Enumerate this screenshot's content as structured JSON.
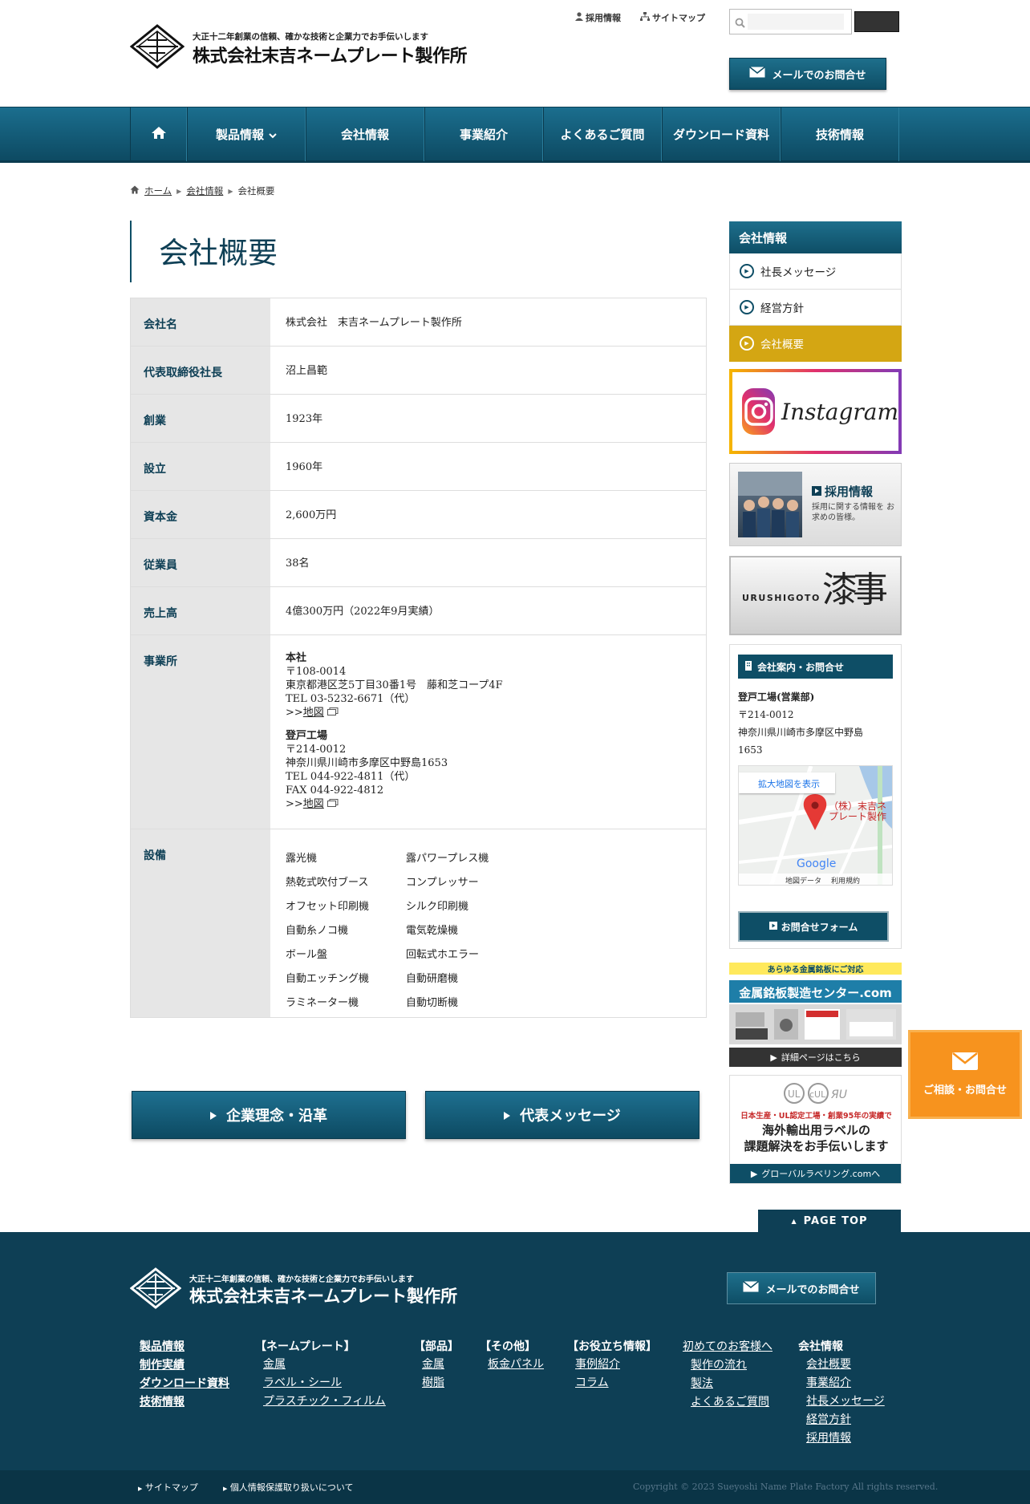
{
  "header": {
    "tagline": "大正十二年創業の信頼、確かな技術と企業力でお手伝いします",
    "company_name": "株式会社末吉ネームプレート製作所",
    "util_links": [
      "採用情報",
      "サイトマップ"
    ],
    "mail_button": "メールでのお問合せ"
  },
  "nav": {
    "items": [
      "製品情報",
      "会社情報",
      "事業紹介",
      "よくあるご質問",
      "ダウンロード資料",
      "技術情報"
    ]
  },
  "breadcrumb": [
    "ホーム",
    "会社情報",
    "会社概要"
  ],
  "page_title": "会社概要",
  "company_table": {
    "rows": [
      {
        "label": "会社名",
        "value": "株式会社　末吉ネームプレート製作所"
      },
      {
        "label": "代表取締役社長",
        "value": "沼上昌範"
      },
      {
        "label": "創業",
        "value": "1923年"
      },
      {
        "label": "設立",
        "value": "1960年"
      },
      {
        "label": "資本金",
        "value": "2,600万円"
      },
      {
        "label": "従業員",
        "value": "38名"
      },
      {
        "label": "売上高",
        "value": "4億300万円（2022年9月実績）"
      }
    ],
    "offices_label": "事業所",
    "offices": [
      {
        "name": "本社",
        "lines": [
          "〒108-0014",
          "東京都港区芝5丁目30番1号　藤和芝コープ4F",
          "TEL 03-5232-6671（代）"
        ],
        "map_prefix": ">>",
        "map_link": "地図"
      },
      {
        "name": "登戸工場",
        "lines": [
          "〒214-0012",
          "神奈川県川崎市多摩区中野島1653",
          "TEL 044-922-4811（代）",
          "FAX 044-922-4812"
        ],
        "map_prefix": ">>",
        "map_link": "地図"
      }
    ],
    "equipment_label": "設備",
    "equipment": [
      "露光機",
      "露パワープレス機",
      "熱乾式吹付ブース",
      "コンプレッサー",
      "オフセット印刷機",
      "シルク印刷機",
      "自動糸ノコ機",
      "電気乾燥機",
      "ボール盤",
      "回転式ホエラー",
      "自動エッチング機",
      "自動研磨機",
      "ラミネーター機",
      "自動切断機"
    ]
  },
  "bottom_buttons": [
    "企業理念・沿革",
    "代表メッセージ"
  ],
  "sidebar": {
    "heading": "会社情報",
    "items": [
      "社長メッセージ",
      "経営方針",
      "会社概要"
    ],
    "instagram": "Instagram",
    "recruit_title": "採用情報",
    "recruit_text": "採用に関する情報を お求めの皆様。",
    "urushigoto": "URUSHIGOTO",
    "urushigoto_kanji": "漆事",
    "contact_heading": "会社案内・お問合せ",
    "contact_office": "登戸工場(営業部)",
    "contact_lines": [
      "〒214-0012",
      "神奈川県川崎市多摩区中野島",
      "1653"
    ],
    "map_enlarge": "拡大地図を表示",
    "map_pin_label": "（株）末吉ネ プレート製作",
    "map_google": "Google",
    "map_footer": [
      "地図データ",
      "利用規約"
    ],
    "form_button": "お問合せフォーム",
    "metal_tag": "あらゆる金属銘板にご対応",
    "metal_title": "金属銘板製造センター.com",
    "metal_link": "詳細ページはこちら",
    "global_tag": "日本生産・UL認定工場・創業95年の実績で",
    "global_title_1": "海外輸出用ラベルの",
    "global_title_2": "課題解決をお手伝いします",
    "global_link": "グローバルラベリング.comへ"
  },
  "float_contact": "ご相談・お問合せ",
  "page_top": "PAGE TOP",
  "footer": {
    "tagline": "大正十二年創業の信頼、確かな技術と企業力でお手伝いします",
    "company_name": "株式会社末吉ネームプレート製作所",
    "mail_button": "メールでのお問合せ",
    "col1": [
      "製品情報",
      "制作実績",
      "ダウンロード資料",
      "技術情報"
    ],
    "col2": {
      "heading": "【ネームプレート】",
      "links": [
        "金属",
        "ラベル・シール",
        "プラスチック・フィルム"
      ]
    },
    "col3": {
      "heading": "【部品】",
      "links": [
        "金属",
        "樹脂"
      ]
    },
    "col4": {
      "heading": "【その他】",
      "links": [
        "板金パネル"
      ]
    },
    "col5": {
      "heading": "【お役立ち情報】",
      "links": [
        "事例紹介",
        "コラム"
      ]
    },
    "col6": {
      "heading": "初めてのお客様へ",
      "links": [
        "製作の流れ",
        "製法",
        "よくあるご質問"
      ]
    },
    "col7": {
      "heading": "会社情報",
      "links": [
        "会社概要",
        "事業紹介",
        "社長メッセージ",
        "経営方針",
        "採用情報"
      ]
    },
    "bottom_links": [
      "サイトマップ",
      "個人情報保護取り扱いについて"
    ],
    "copyright": "Copyright © 2023 Sueyoshi Name Plate Factory All rights reserved."
  },
  "colors": {
    "primary": "#0e4e66",
    "accent_gold": "#d4a613",
    "float_orange": "#f7931e",
    "footer_bg": "#0e3f55"
  }
}
